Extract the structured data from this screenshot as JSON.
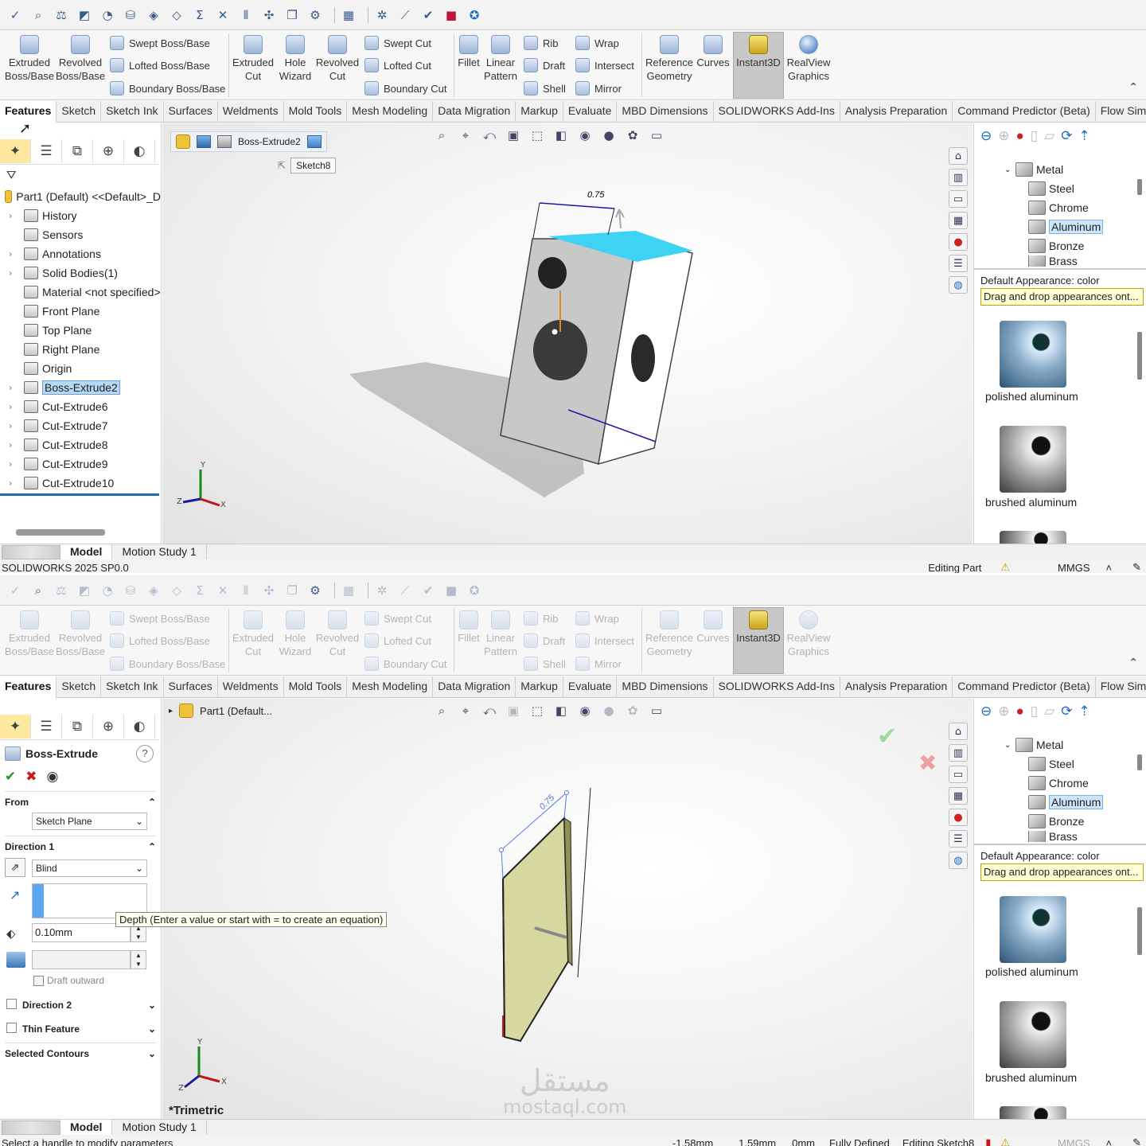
{
  "quick_toolbar": {
    "icons": [
      "spell-check-icon",
      "measure-icon",
      "mass-properties-icon",
      "section-icon",
      "sensor-icon",
      "pack-icon",
      "check-icon",
      "geometry-analysis-icon",
      "sum-icon",
      "intersection-icon",
      "symmetry-icon",
      "move-face-icon",
      "copy-icon",
      "evaluate-icon",
      "table-icon",
      "gear-icon",
      "ruler-icon",
      "checkmark-icon",
      "record-icon",
      "settings-icon"
    ]
  },
  "ribbon": {
    "extruded_boss": "Extruded\nBoss/Base",
    "revolved_boss": "Revolved\nBoss/Base",
    "swept_boss": "Swept Boss/Base",
    "lofted_boss": "Lofted Boss/Base",
    "boundary_boss": "Boundary Boss/Base",
    "extruded_cut": "Extruded\nCut",
    "hole_wizard": "Hole\nWizard",
    "revolved_cut": "Revolved\nCut",
    "swept_cut": "Swept Cut",
    "lofted_cut": "Lofted Cut",
    "boundary_cut": "Boundary Cut",
    "fillet": "Fillet",
    "linear_pattern": "Linear\nPattern",
    "rib": "Rib",
    "draft": "Draft",
    "shell": "Shell",
    "wrap": "Wrap",
    "intersect": "Intersect",
    "mirror": "Mirror",
    "reference_geometry": "Reference\nGeometry",
    "curves": "Curves",
    "instant3d": "Instant3D",
    "realview": "RealView\nGraphics"
  },
  "tabs": [
    "Features",
    "Sketch",
    "Sketch Ink",
    "Surfaces",
    "Weldments",
    "Mold Tools",
    "Mesh Modeling",
    "Data Migration",
    "Markup",
    "Evaluate",
    "MBD Dimensions",
    "SOLIDWORKS Add-Ins",
    "Analysis Preparation",
    "Command Predictor (Beta)",
    "Flow Simul..."
  ],
  "tree": {
    "root": "Part1 (Default) <<Default>_D",
    "items": [
      {
        "label": "History",
        "expand": "›"
      },
      {
        "label": "Sensors",
        "expand": ""
      },
      {
        "label": "Annotations",
        "expand": "›"
      },
      {
        "label": "Solid Bodies(1)",
        "expand": "›"
      },
      {
        "label": "Material <not specified>",
        "expand": ""
      },
      {
        "label": "Front Plane",
        "expand": ""
      },
      {
        "label": "Top Plane",
        "expand": ""
      },
      {
        "label": "Right Plane",
        "expand": ""
      },
      {
        "label": "Origin",
        "expand": ""
      },
      {
        "label": "Boss-Extrude2",
        "expand": "›"
      },
      {
        "label": "Cut-Extrude6",
        "expand": "›"
      },
      {
        "label": "Cut-Extrude7",
        "expand": "›"
      },
      {
        "label": "Cut-Extrude8",
        "expand": "›"
      },
      {
        "label": "Cut-Extrude9",
        "expand": "›"
      },
      {
        "label": "Cut-Extrude10",
        "expand": "›"
      }
    ]
  },
  "viewport_top": {
    "breadcrumb_feature": "Boss-Extrude2",
    "breadcrumb_sketch": "Sketch8",
    "dim_top": "0.75"
  },
  "appearances": {
    "folder": "Metal",
    "items": [
      "Steel",
      "Chrome",
      "Aluminum",
      "Bronze",
      "Brass"
    ],
    "default_appearance": "Default Appearance: color",
    "drag_note": "Drag and drop appearances ont...",
    "swatch1": "polished aluminum",
    "swatch2": "brushed aluminum"
  },
  "bottom_tabs": {
    "model": "Model",
    "motion": "Motion Study 1"
  },
  "status_top": {
    "version": "SOLIDWORKS 2025 SP0.0",
    "mode": "Editing Part",
    "units": "MMGS"
  },
  "property_manager": {
    "title": "Boss-Extrude",
    "help": "?",
    "from_label": "From",
    "from_value": "Sketch Plane",
    "direction1_label": "Direction 1",
    "end_condition": "Blind",
    "depth_value": "0.10mm",
    "tooltip": "Depth (Enter a value or start with = to create an equation)",
    "draft_outward": "Draft outward",
    "direction2_label": "Direction 2",
    "thin_feature_label": "Thin Feature",
    "selected_contours_label": "Selected Contours"
  },
  "viewport_bottom": {
    "part_crumb": "Part1 (Default...",
    "dim_a": "0.75",
    "view_name": "*Trimetric"
  },
  "watermark": {
    "line1": "مستقل",
    "line2": "mostaql.com"
  },
  "status_bottom": {
    "hint": "Select a handle to modify parameters",
    "x": "-1.58mm",
    "y": "1.59mm",
    "z": "0mm",
    "state": "Fully Defined",
    "editing": "Editing Sketch8",
    "units": "MMGS"
  },
  "colors": {
    "accent": "#1b6cc0",
    "selection": "#b7d7f7",
    "highlight_face": "#3fd3f3",
    "dim_blue": "#1a1aa0",
    "preview_face": "#d7d8a0"
  }
}
